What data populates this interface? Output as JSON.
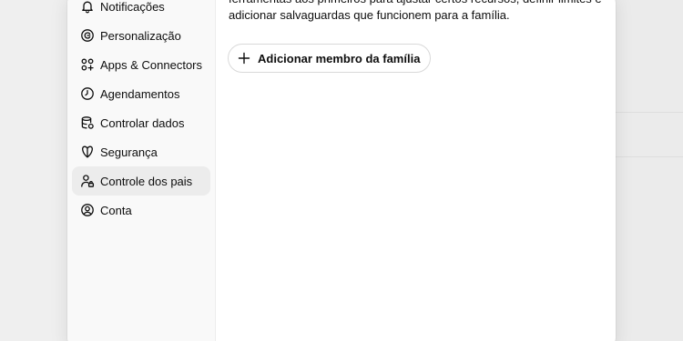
{
  "sidebar": {
    "items": [
      {
        "label": "Notificações",
        "icon": "bell-icon"
      },
      {
        "label": "Personalização",
        "icon": "personalization-icon"
      },
      {
        "label": "Apps & Connectors",
        "icon": "apps-icon"
      },
      {
        "label": "Agendamentos",
        "icon": "clock-icon"
      },
      {
        "label": "Controlar dados",
        "icon": "database-icon"
      },
      {
        "label": "Segurança",
        "icon": "shield-icon"
      },
      {
        "label": "Controle dos pais",
        "icon": "parent-user-icon",
        "active": true
      },
      {
        "label": "Conta",
        "icon": "account-circle-icon"
      }
    ]
  },
  "main": {
    "description_line1": "ferramentas aos primeiros para ajustar certos recursos, definir limites e",
    "description_line2": "adicionar salvaguardas que funcionem para a família.",
    "add_member_label": "Adicionar membro da família"
  }
}
